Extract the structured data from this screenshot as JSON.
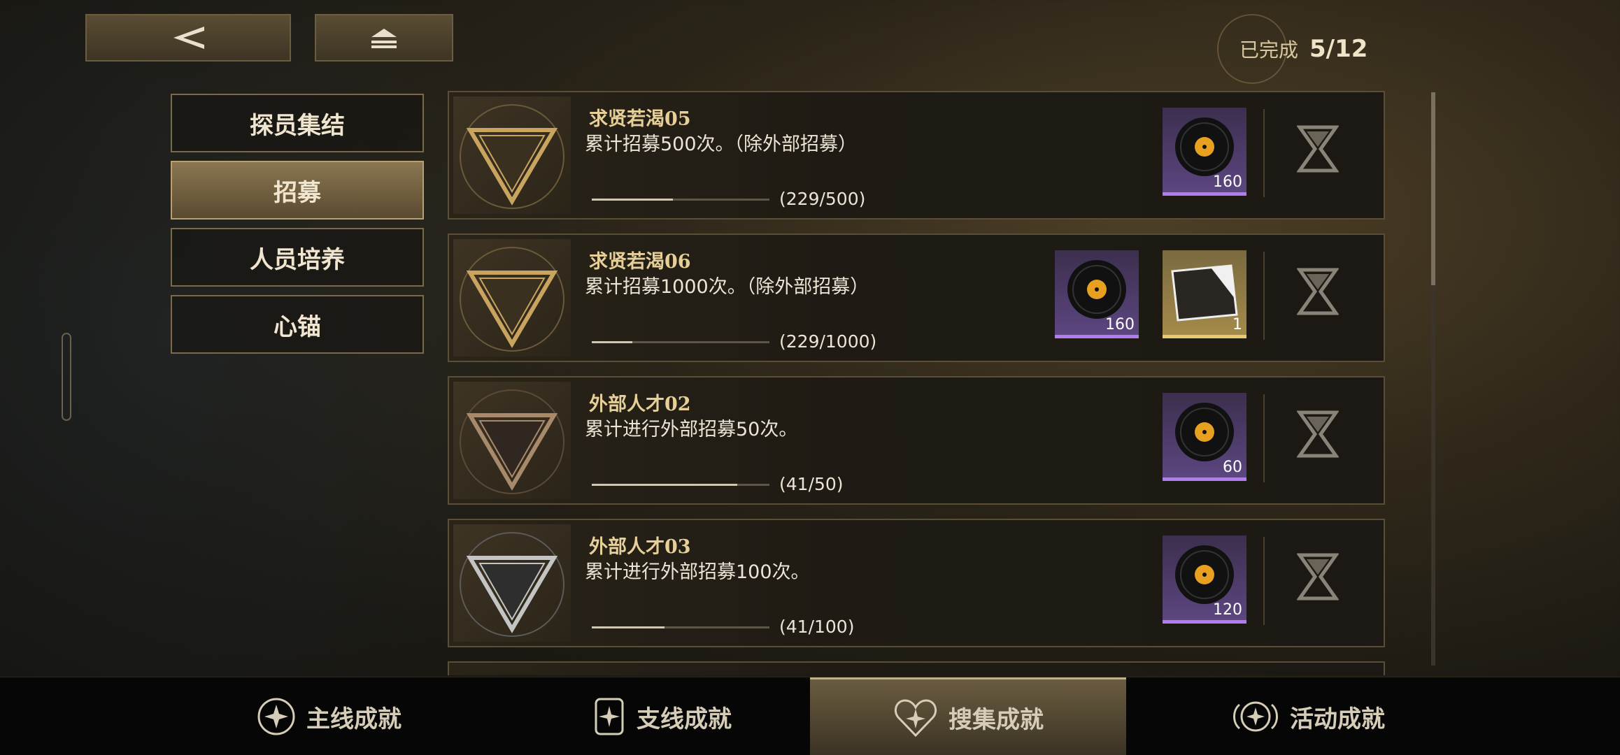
{
  "header": {
    "back_icon": "back-arrow-icon",
    "home_icon": "home-eject-icon",
    "completed_label": "已完成",
    "completed_count": "5/12"
  },
  "categories": [
    {
      "label": "探员集结",
      "active": false
    },
    {
      "label": "招募",
      "active": true
    },
    {
      "label": "人员培养",
      "active": false
    },
    {
      "label": "心锚",
      "active": false
    }
  ],
  "achievements": [
    {
      "title": "求贤若渴05",
      "description": "累计招募500次。（除外部招募）",
      "progress_text": "(229/500)",
      "progress_fraction": 0.458,
      "emblem": "III",
      "emblem_color": "#c9a45e",
      "rewards": [
        {
          "icon": "vinyl-record-icon",
          "rarity": "purple",
          "qty": "160"
        }
      ],
      "status_icon": "hourglass-icon"
    },
    {
      "title": "求贤若渴06",
      "description": "累计招募1000次。（除外部招募）",
      "progress_text": "(229/1000)",
      "progress_fraction": 0.229,
      "emblem": "III",
      "emblem_color": "#c9a45e",
      "rewards": [
        {
          "icon": "vinyl-record-icon",
          "rarity": "purple",
          "qty": "160"
        },
        {
          "icon": "ticket-icon",
          "rarity": "gold",
          "qty": "1"
        }
      ],
      "status_icon": "hourglass-icon"
    },
    {
      "title": "外部人才02",
      "description": "累计进行外部招募50次。",
      "progress_text": "(41/50)",
      "progress_fraction": 0.82,
      "emblem": "I",
      "emblem_color": "#a8896a",
      "rewards": [
        {
          "icon": "vinyl-record-icon",
          "rarity": "purple",
          "qty": "60"
        }
      ],
      "status_icon": "hourglass-icon"
    },
    {
      "title": "外部人才03",
      "description": "累计进行外部招募100次。",
      "progress_text": "(41/100)",
      "progress_fraction": 0.41,
      "emblem": "II",
      "emblem_color": "#c4c4c4",
      "rewards": [
        {
          "icon": "vinyl-record-icon",
          "rarity": "purple",
          "qty": "120"
        }
      ],
      "status_icon": "hourglass-icon"
    }
  ],
  "bottom_tabs": [
    {
      "label": "主线成就",
      "icon": "star-badge-icon",
      "active": false
    },
    {
      "label": "支线成就",
      "icon": "star-card-icon",
      "active": false
    },
    {
      "label": "搜集成就",
      "icon": "star-heart-icon",
      "active": true
    },
    {
      "label": "活动成就",
      "icon": "star-wings-icon",
      "active": false
    }
  ]
}
